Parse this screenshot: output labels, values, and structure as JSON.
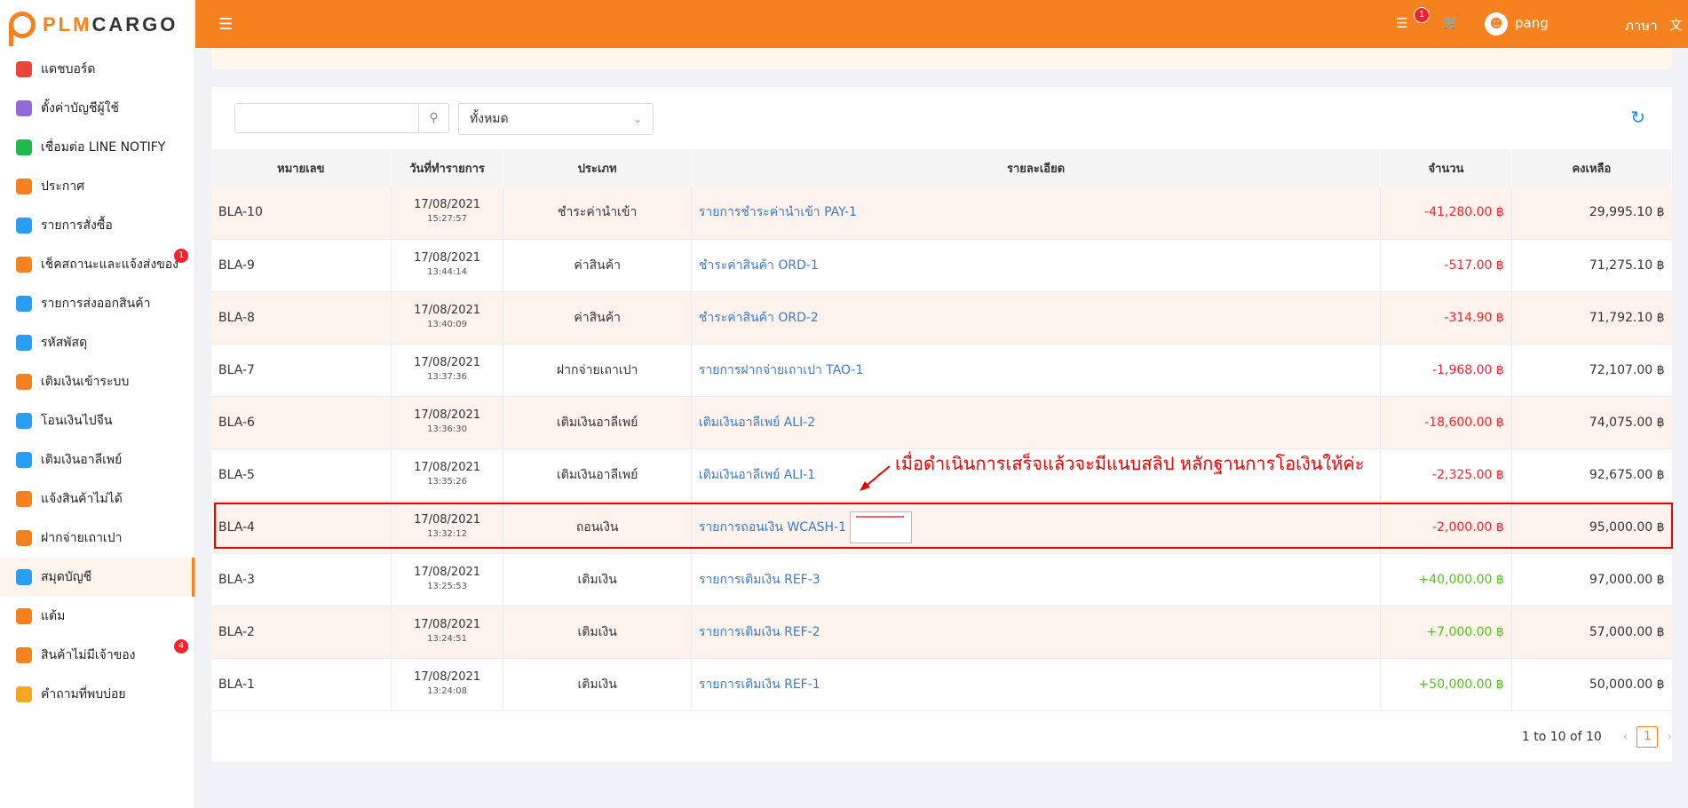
{
  "app": {
    "logo_left": "PLM",
    "logo_right": "CARGO"
  },
  "header": {
    "notif_count": "1",
    "username": "pang",
    "language": "ภาษา"
  },
  "sidebar": {
    "items": [
      {
        "label": "แดชบอร์ด",
        "icon": "chart-area-icon",
        "color": "#e8453c",
        "badge": ""
      },
      {
        "label": "ตั้งค่าบัญชีผู้ใช้",
        "icon": "user-settings-icon",
        "color": "#8e6bd8",
        "badge": ""
      },
      {
        "label": "เชื่อมต่อ LINE NOTIFY",
        "icon": "line-icon",
        "color": "#1fb84b",
        "badge": ""
      },
      {
        "label": "ประกาศ",
        "icon": "megaphone-icon",
        "color": "#f5821f",
        "badge": ""
      },
      {
        "label": "รายการสั่งซื้อ",
        "icon": "shopping-bag-icon",
        "color": "#2a9df4",
        "badge": ""
      },
      {
        "label": "เช็คสถานะและแจ้งส่งของ",
        "icon": "truck-icon",
        "color": "#f5821f",
        "badge": "1"
      },
      {
        "label": "รายการส่งออกสินค้า",
        "icon": "dolly-icon",
        "color": "#2a9df4",
        "badge": ""
      },
      {
        "label": "รหัสพัสดุ",
        "icon": "box-icon",
        "color": "#2a9df4",
        "badge": ""
      },
      {
        "label": "เติมเงินเข้าระบบ",
        "icon": "piggy-bank-icon",
        "color": "#f5821f",
        "badge": ""
      },
      {
        "label": "โอนเงินไปจีน",
        "icon": "yuan-icon",
        "color": "#2a9df4",
        "badge": ""
      },
      {
        "label": "เติมเงินอาลีเพย์",
        "icon": "alipay-icon",
        "color": "#2a9df4",
        "badge": ""
      },
      {
        "label": "แจ้งสินค้าไม่ได้",
        "icon": "no-box-icon",
        "color": "#f5821f",
        "badge": ""
      },
      {
        "label": "ฝากจ่ายเถาเปา",
        "icon": "taobao-icon",
        "color": "#f5821f",
        "badge": ""
      },
      {
        "label": "สมุดบัญชี",
        "icon": "wallet-icon",
        "color": "#2a9df4",
        "badge": ""
      },
      {
        "label": "แต้ม",
        "icon": "medal-icon",
        "color": "#f5821f",
        "badge": ""
      },
      {
        "label": "สินค้าไม่มีเจ้าของ",
        "icon": "search-box-icon",
        "color": "#f5821f",
        "badge": "4"
      },
      {
        "label": "คำถามที่พบบ่อย",
        "icon": "question-icon",
        "color": "#f5a623",
        "badge": ""
      }
    ]
  },
  "toolbar": {
    "search_placeholder": "",
    "filter_value": "ทั้งหมด"
  },
  "table": {
    "headers": [
      "หมายเลข",
      "วันที่ทำรายการ",
      "ประเภท",
      "รายละเอียด",
      "จำนวน",
      "คงเหลือ"
    ],
    "rows": [
      {
        "num": "BLA-10",
        "date": "17/08/2021",
        "time": "15:27:57",
        "type": "ชำระค่านำเข้า",
        "detail": "รายการชำระค่านำเข้า PAY-1",
        "amount": "-41,280.00 ฿",
        "balance": "29,995.10 ฿",
        "sign": "neg"
      },
      {
        "num": "BLA-9",
        "date": "17/08/2021",
        "time": "13:44:14",
        "type": "ค่าสินค้า",
        "detail": "ชำระค่าสินค้า ORD-1",
        "amount": "-517.00 ฿",
        "balance": "71,275.10 ฿",
        "sign": "neg"
      },
      {
        "num": "BLA-8",
        "date": "17/08/2021",
        "time": "13:40:09",
        "type": "ค่าสินค้า",
        "detail": "ชำระค่าสินค้า ORD-2",
        "amount": "-314.90 ฿",
        "balance": "71,792.10 ฿",
        "sign": "neg"
      },
      {
        "num": "BLA-7",
        "date": "17/08/2021",
        "time": "13:37:36",
        "type": "ฝากจ่ายเถาเปา",
        "detail": "รายการฝากจ่ายเถาเปา TAO-1",
        "amount": "-1,968.00 ฿",
        "balance": "72,107.00 ฿",
        "sign": "neg"
      },
      {
        "num": "BLA-6",
        "date": "17/08/2021",
        "time": "13:36:30",
        "type": "เติมเงินอาลีเพย์",
        "detail": "เติมเงินอาลีเพย์ ALI-2",
        "amount": "-18,600.00 ฿",
        "balance": "74,075.00 ฿",
        "sign": "neg"
      },
      {
        "num": "BLA-5",
        "date": "17/08/2021",
        "time": "13:35:26",
        "type": "เติมเงินอาลีเพย์",
        "detail": "เติมเงินอาลีเพย์ ALI-1",
        "amount": "-2,325.00 ฿",
        "balance": "92,675.00 ฿",
        "sign": "neg"
      },
      {
        "num": "BLA-4",
        "date": "17/08/2021",
        "time": "13:32:12",
        "type": "ถอนเงิน",
        "detail": "รายการถอนเงิน WCASH-1",
        "amount": "-2,000.00 ฿",
        "balance": "95,000.00 ฿",
        "sign": "neg",
        "thumb": true
      },
      {
        "num": "BLA-3",
        "date": "17/08/2021",
        "time": "13:25:53",
        "type": "เติมเงิน",
        "detail": "รายการเติมเงิน REF-3",
        "amount": "+40,000.00 ฿",
        "balance": "97,000.00 ฿",
        "sign": "pos"
      },
      {
        "num": "BLA-2",
        "date": "17/08/2021",
        "time": "13:24:51",
        "type": "เติมเงิน",
        "detail": "รายการเติมเงิน REF-2",
        "amount": "+7,000.00 ฿",
        "balance": "57,000.00 ฿",
        "sign": "pos"
      },
      {
        "num": "BLA-1",
        "date": "17/08/2021",
        "time": "13:24:08",
        "type": "เติมเงิน",
        "detail": "รายการเติมเงิน REF-1",
        "amount": "+50,000.00 ฿",
        "balance": "50,000.00 ฿",
        "sign": "pos"
      }
    ]
  },
  "annotation": {
    "text": "เมื่อดำเนินการเสร็จแล้วจะมีแนบสลิป หลักฐานการโอเงินให้ค่ะ"
  },
  "pagination": {
    "summary": "1 to 10 of 10",
    "current_page": "1"
  },
  "colors": {
    "brand": "#f5821f",
    "negative": "#f5222d",
    "positive": "#52c41a",
    "link": "#3c7ac9"
  }
}
